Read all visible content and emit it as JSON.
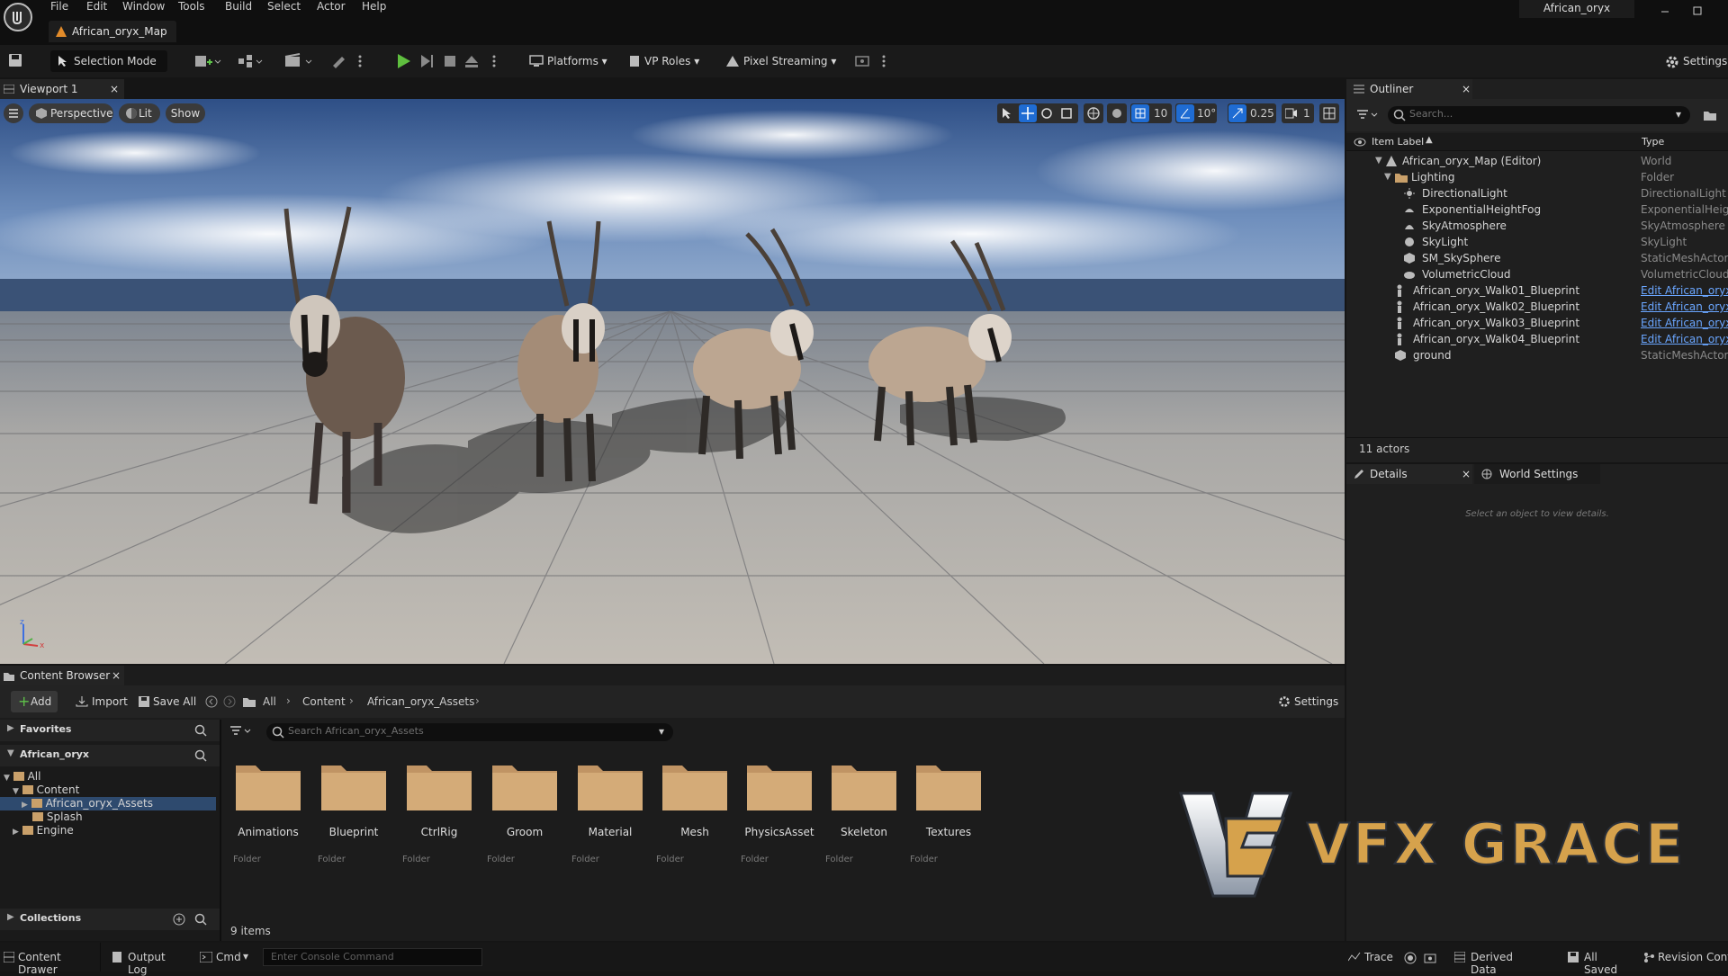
{
  "window": {
    "menu": [
      "File",
      "Edit",
      "Window",
      "Tools",
      "Build",
      "Select",
      "Actor",
      "Help"
    ],
    "map_tab": "African_oryx_Map",
    "project_name": "African_oryx"
  },
  "toolbar": {
    "selection_mode": "Selection Mode",
    "platforms": "Platforms",
    "vp_roles": "VP Roles",
    "pixel_streaming": "Pixel Streaming",
    "settings": "Settings"
  },
  "viewport": {
    "tab": "Viewport 1",
    "perspective": "Perspective",
    "lit": "Lit",
    "show": "Show",
    "grid_snap": "10",
    "rotation_snap": "10°",
    "scale_snap": "0.25",
    "camera_speed": "1"
  },
  "outliner": {
    "tab": "Outliner",
    "search_placeholder": "Search...",
    "col_label": "Item Label",
    "col_type": "Type",
    "items": [
      {
        "label": "African_oryx_Map (Editor)",
        "type": "World"
      },
      {
        "label": "Lighting",
        "type": "Folder"
      },
      {
        "label": "DirectionalLight",
        "type": "DirectionalLight"
      },
      {
        "label": "ExponentialHeightFog",
        "type": "ExponentialHeightFog"
      },
      {
        "label": "SkyAtmosphere",
        "type": "SkyAtmosphere"
      },
      {
        "label": "SkyLight",
        "type": "SkyLight"
      },
      {
        "label": "SM_SkySphere",
        "type": "StaticMeshActor"
      },
      {
        "label": "VolumetricCloud",
        "type": "VolumetricCloud"
      },
      {
        "label": "African_oryx_Walk01_Blueprint",
        "type": "Edit African_oryx_"
      },
      {
        "label": "African_oryx_Walk02_Blueprint",
        "type": "Edit African_oryx_"
      },
      {
        "label": "African_oryx_Walk03_Blueprint",
        "type": "Edit African_oryx_"
      },
      {
        "label": "African_oryx_Walk04_Blueprint",
        "type": "Edit African_oryx_"
      },
      {
        "label": "ground",
        "type": "StaticMeshActor"
      }
    ],
    "count": "11 actors"
  },
  "details": {
    "tab": "Details",
    "world_settings_tab": "World Settings",
    "empty_msg": "Select an object to view details."
  },
  "content_browser": {
    "tab": "Content Browser",
    "add": "Add",
    "import": "Import",
    "save_all": "Save All",
    "breadcrumb": [
      "All",
      "Content",
      "African_oryx_Assets"
    ],
    "settings": "Settings",
    "favorites": "Favorites",
    "project": "African_oryx",
    "tree": [
      "All",
      "Content",
      "African_oryx_Assets",
      "Splash",
      "Engine"
    ],
    "collections": "Collections",
    "search_placeholder": "Search African_oryx_Assets",
    "folders": [
      {
        "name": "Animations",
        "kind": "Folder"
      },
      {
        "name": "Blueprint",
        "kind": "Folder"
      },
      {
        "name": "CtrlRig",
        "kind": "Folder"
      },
      {
        "name": "Groom",
        "kind": "Folder"
      },
      {
        "name": "Material",
        "kind": "Folder"
      },
      {
        "name": "Mesh",
        "kind": "Folder"
      },
      {
        "name": "PhysicsAsset",
        "kind": "Folder"
      },
      {
        "name": "Skeleton",
        "kind": "Folder"
      },
      {
        "name": "Textures",
        "kind": "Folder"
      }
    ],
    "item_count": "9 items"
  },
  "watermark": "VFX GRACE",
  "statusbar": {
    "content_drawer": "Content Drawer",
    "output_log": "Output Log",
    "cmd": "Cmd",
    "console_placeholder": "Enter Console Command",
    "trace": "Trace",
    "derived_data": "Derived Data",
    "all_saved": "All Saved",
    "revision_control": "Revision Control"
  }
}
